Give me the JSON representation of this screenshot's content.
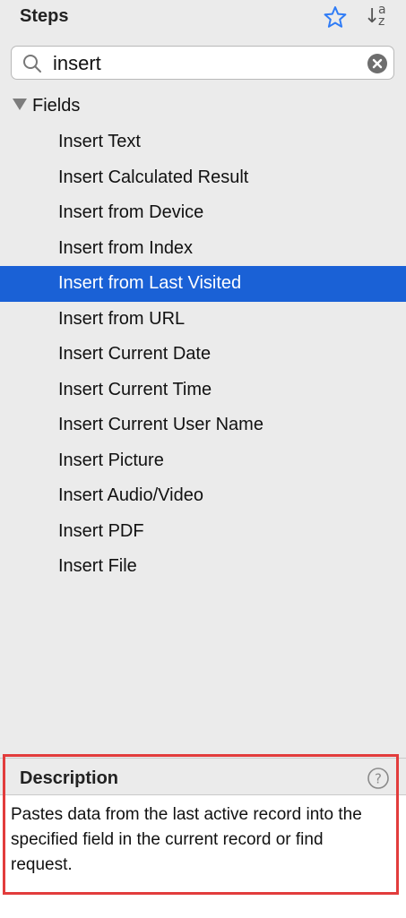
{
  "header": {
    "title": "Steps",
    "favorites_icon": "star-icon",
    "sort_icon": "sort-az-icon",
    "sort_glyph_a": "a",
    "sort_glyph_z": "z"
  },
  "search": {
    "value": "insert",
    "search_icon": "magnifier-icon",
    "clear_icon": "clear-circle-icon"
  },
  "group": {
    "label": "Fields",
    "expanded": true
  },
  "items": [
    {
      "label": "Insert Text"
    },
    {
      "label": "Insert Calculated Result"
    },
    {
      "label": "Insert from Device"
    },
    {
      "label": "Insert from Index"
    },
    {
      "label": "Insert from Last Visited",
      "selected": true
    },
    {
      "label": "Insert from URL"
    },
    {
      "label": "Insert Current Date"
    },
    {
      "label": "Insert Current Time"
    },
    {
      "label": "Insert Current User Name"
    },
    {
      "label": "Insert Picture"
    },
    {
      "label": "Insert Audio/Video"
    },
    {
      "label": "Insert PDF"
    },
    {
      "label": "Insert File"
    }
  ],
  "description": {
    "title": "Description",
    "help_icon": "help-icon",
    "text": "Pastes data from the last active record into the specified field in the current record or find request."
  },
  "colors": {
    "selection": "#1a61d6",
    "accent_icon": "#2f7cf6",
    "highlight_border": "#e23c3c",
    "panel_bg": "#ebebeb"
  }
}
